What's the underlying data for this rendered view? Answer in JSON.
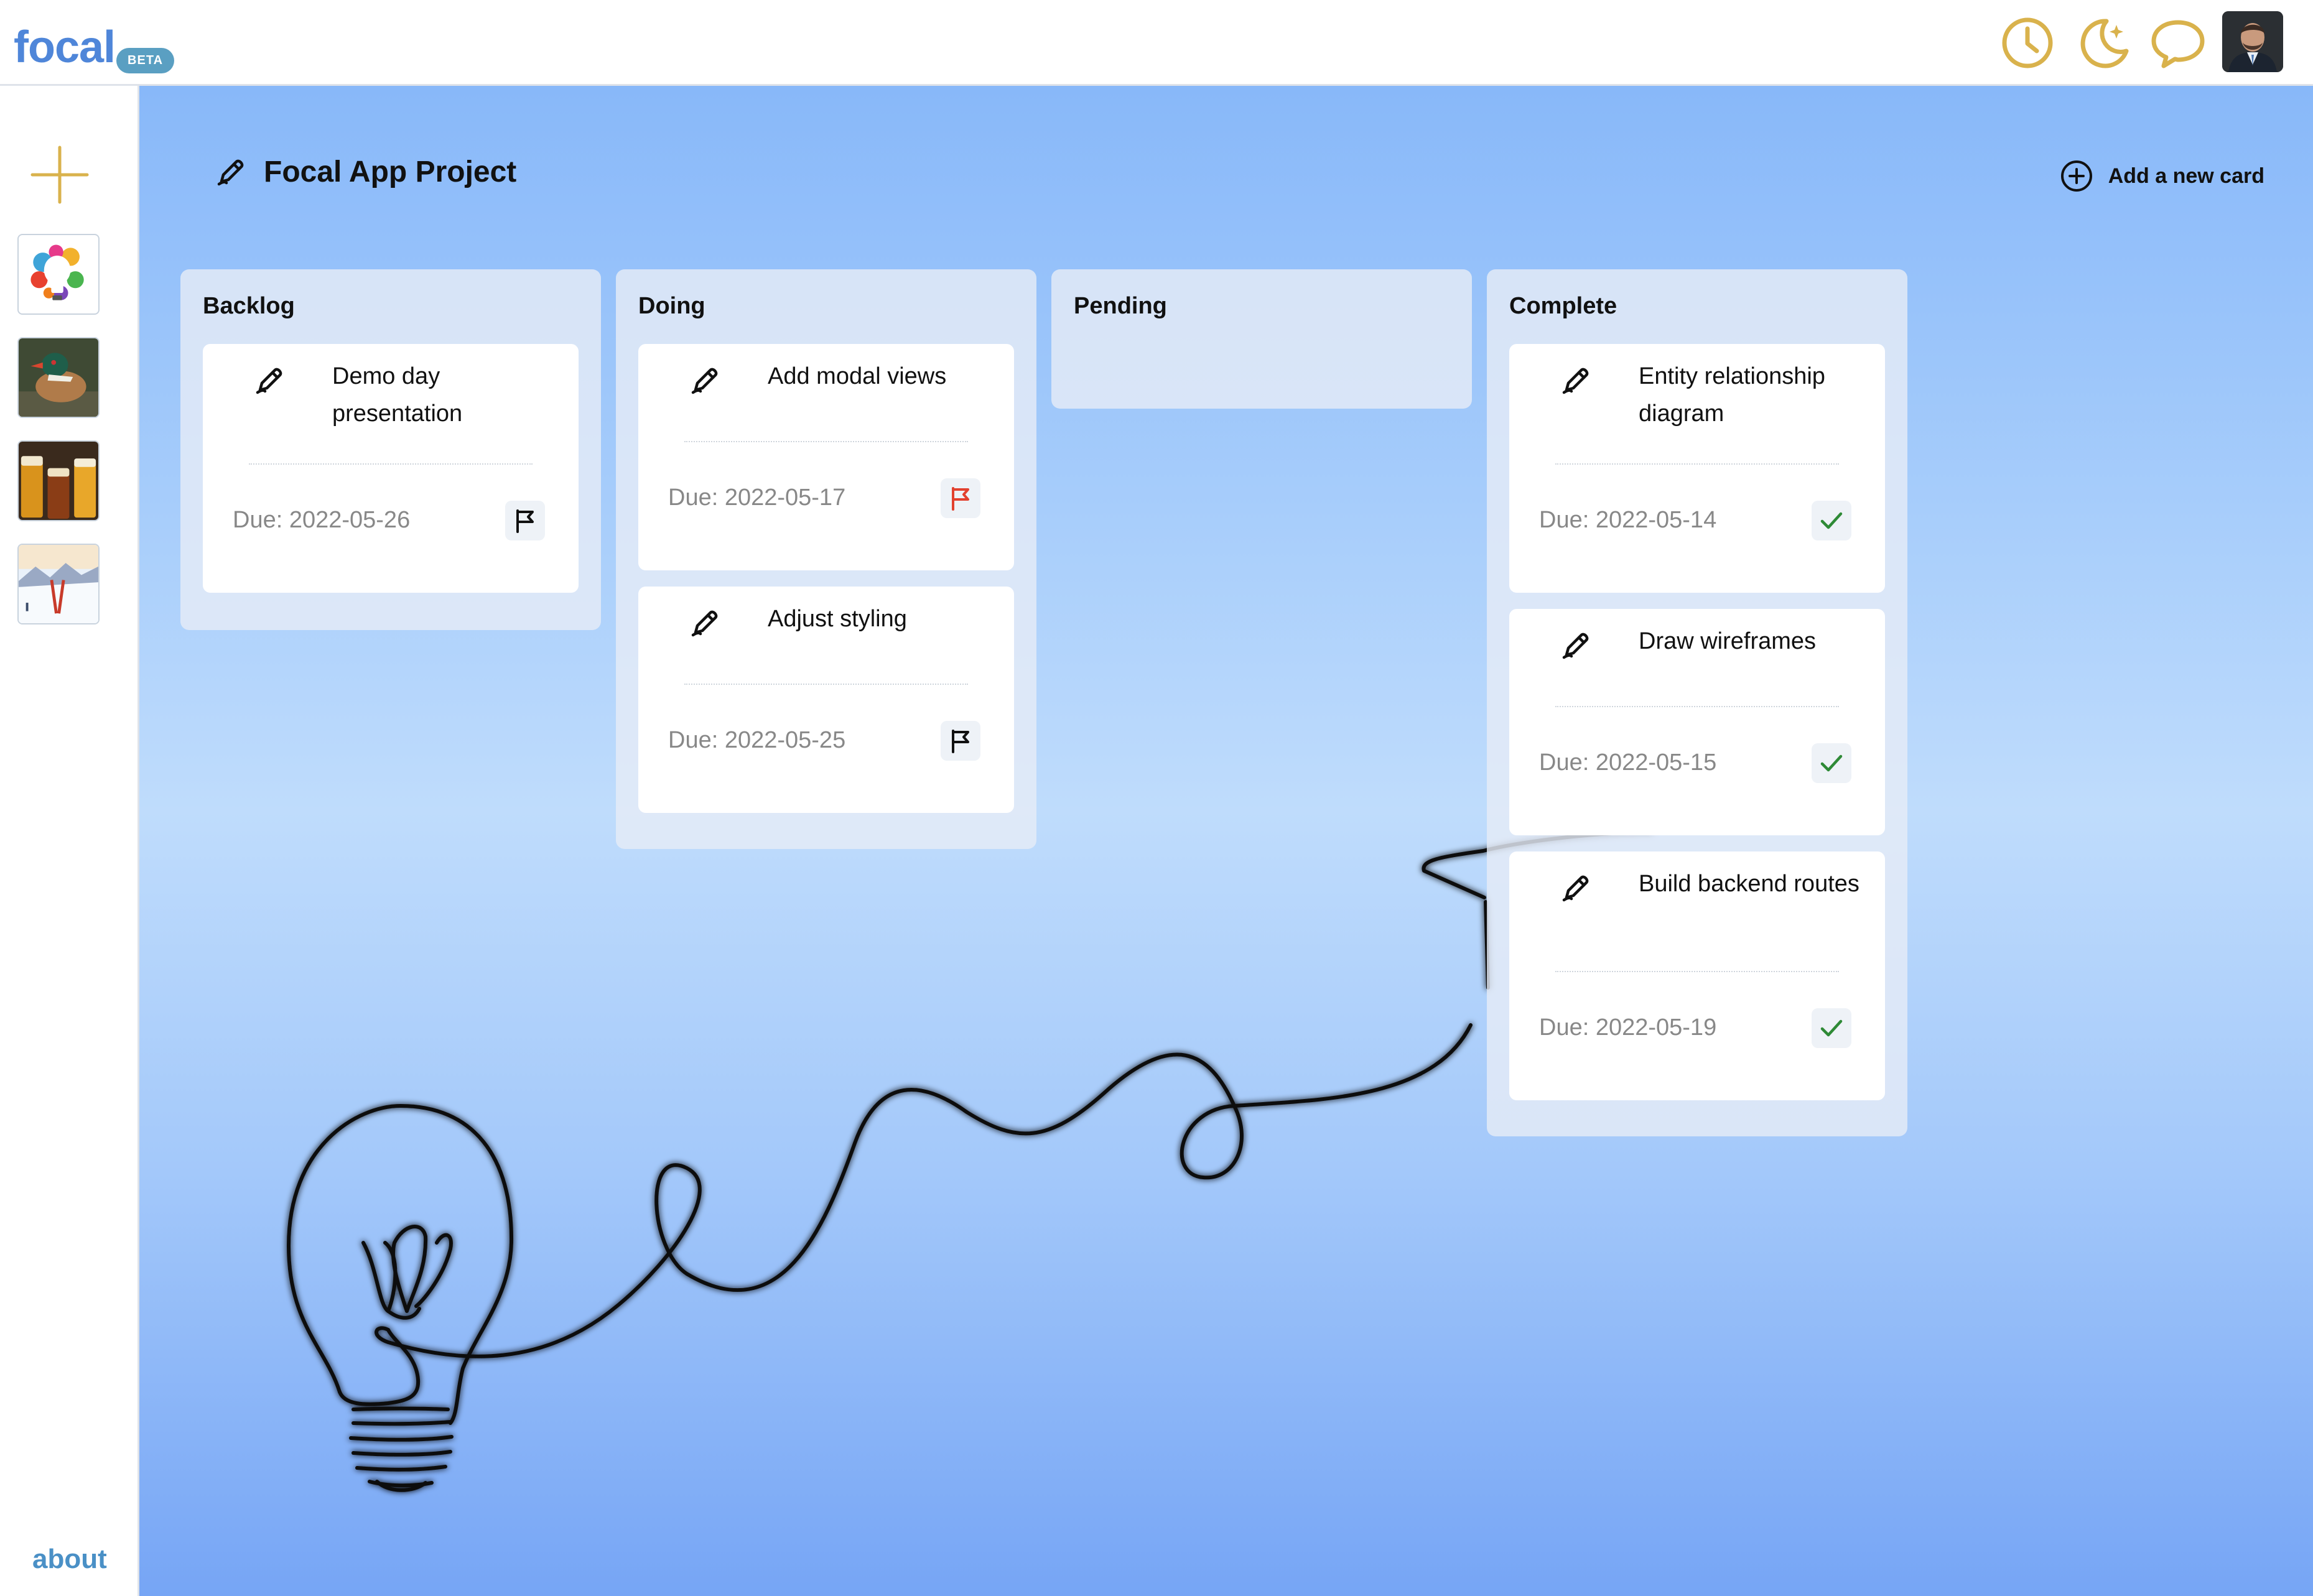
{
  "app": {
    "logo_text": "focal",
    "badge": "BETA"
  },
  "header_icons": [
    "clock-icon",
    "moon-stars-icon",
    "chat-bubble-icon",
    "user-avatar"
  ],
  "sidebar": {
    "add_icon": "plus-icon",
    "boards": [
      "lightbulb-paint-board",
      "duck-photo-board",
      "beer-glasses-board",
      "ski-mountain-board"
    ],
    "about_label": "about"
  },
  "board": {
    "title": "Focal App Project",
    "add_card_label": "Add a new card"
  },
  "columns": [
    {
      "title": "Backlog",
      "cards": [
        {
          "title": "Demo day presentation",
          "due": "Due: 2022-05-26",
          "status": "flag-black"
        }
      ]
    },
    {
      "title": "Doing",
      "cards": [
        {
          "title": "Add modal views",
          "due": "Due: 2022-05-17",
          "status": "flag-red"
        },
        {
          "title": "Adjust styling",
          "due": "Due: 2022-05-25",
          "status": "flag-black"
        }
      ]
    },
    {
      "title": "Pending",
      "cards": []
    },
    {
      "title": "Complete",
      "cards": [
        {
          "title": "Entity relationship diagram",
          "due": "Due: 2022-05-14",
          "status": "check-green"
        },
        {
          "title": "Draw wireframes",
          "due": "Due: 2022-05-15",
          "status": "check-green"
        },
        {
          "title": "Build backend routes",
          "due": "Due: 2022-05-19",
          "status": "check-green"
        }
      ]
    }
  ],
  "colors": {
    "accent_gold": "#d9b24c",
    "logo_blue": "#4f86d9",
    "flag_red": "#e2412f",
    "check_green": "#2e8a36",
    "about_blue": "#4a90c6"
  }
}
